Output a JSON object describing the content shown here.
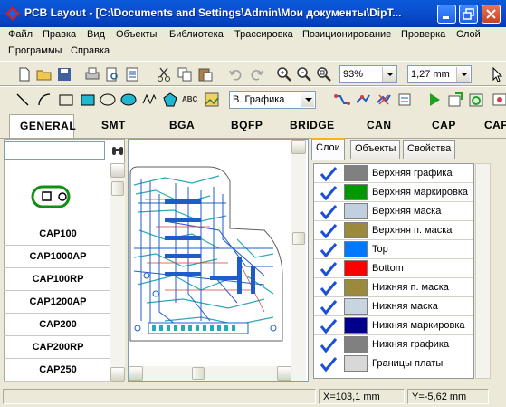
{
  "window": {
    "title": "PCB Layout - [C:\\Documents and Settings\\Admin\\Мои документы\\DipT..."
  },
  "menu": {
    "items": [
      "Файл",
      "Правка",
      "Вид",
      "Объекты",
      "Библиотека",
      "Трассировка",
      "Позиционирование",
      "Проверка",
      "Слой",
      "Программы",
      "Справка"
    ]
  },
  "toolbar": {
    "zoom_value": "93%",
    "grid_value": "1,27 mm",
    "layer_value": "В. Графика",
    "icons": [
      "new-icon",
      "open-icon",
      "save-icon",
      "print-icon",
      "print-preview-icon",
      "report-icon",
      "cut-icon",
      "copy-icon",
      "paste-icon",
      "undo-icon",
      "redo-icon",
      "zoom-in-icon",
      "zoom-out-icon",
      "zoom-fit-icon",
      "select-pointer-icon",
      "line-icon",
      "arc-icon",
      "rectangle-icon",
      "filled-rectangle-icon",
      "ellipse-icon",
      "filled-ellipse-icon",
      "polyline-icon",
      "polygon-icon",
      "text-icon",
      "image-icon",
      "route-icon",
      "autoroute-icon",
      "unroute-icon",
      "netlist-icon",
      "run-icon",
      "export-icon",
      "refresh-icon"
    ],
    "text_icon_label": "ABC"
  },
  "library_tabs": [
    "GENERAL",
    "SMT",
    "BGA",
    "BQFP",
    "BRIDGE",
    "CAN",
    "CAP",
    "CAP"
  ],
  "library": {
    "search_value": "",
    "components": [
      "CAP100",
      "CAP1000AP",
      "CAP100RP",
      "CAP1200AP",
      "CAP200",
      "CAP200RP",
      "CAP250"
    ]
  },
  "right_panel": {
    "tabs": [
      "Слои",
      "Объекты",
      "Свойства"
    ],
    "layers": [
      {
        "name": "Верхняя графика",
        "color": "#808080",
        "checked": true
      },
      {
        "name": "Верхняя маркировка",
        "color": "#009900",
        "checked": true
      },
      {
        "name": "Верхняя маска",
        "color": "#c0d0e0",
        "checked": true
      },
      {
        "name": "Верхняя п. маска",
        "color": "#9c8a3c",
        "checked": true
      },
      {
        "name": "Top",
        "color": "#0078ff",
        "checked": true
      },
      {
        "name": "Bottom",
        "color": "#ff0000",
        "checked": true
      },
      {
        "name": "Нижняя п. маска",
        "color": "#9c8a3c",
        "checked": true
      },
      {
        "name": "Нижняя маска",
        "color": "#c8d4e0",
        "checked": true
      },
      {
        "name": "Нижняя маркировка",
        "color": "#00008b",
        "checked": true
      },
      {
        "name": "Нижняя графика",
        "color": "#808080",
        "checked": true
      },
      {
        "name": "Границы платы",
        "color": "#d8d8d8",
        "checked": true
      }
    ]
  },
  "status": {
    "x": "X=103,1 mm",
    "y": "Y=-5,62 mm"
  },
  "colors": {
    "title_blue": "#0443c0",
    "pcb_trace_blue": "#1e5cc8",
    "pcb_trace_teal": "#2aa8b8",
    "pcb_trace_red": "#d04040",
    "check_blue": "#1c4fd8"
  }
}
